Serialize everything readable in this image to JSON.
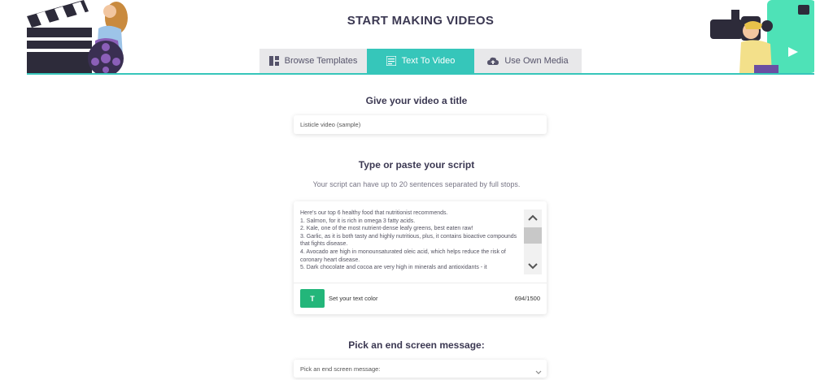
{
  "header": {
    "title": "START MAKING VIDEOS",
    "tabs": [
      {
        "label": "Browse Templates",
        "icon": "grid-icon",
        "active": false
      },
      {
        "label": "Text To Video",
        "icon": "document-icon",
        "active": true
      },
      {
        "label": "Use Own Media",
        "icon": "cloud-upload-icon",
        "active": false
      }
    ]
  },
  "title_section": {
    "heading": "Give your video a title",
    "input_value": "Listicle video (sample)"
  },
  "script_section": {
    "heading": "Type or paste your script",
    "hint": "Your script can have up to 20 sentences separated by full stops.",
    "text": "Here's our top 6 healthy food that nutritionist recommends.\n1. Salmon, for it is rich in omega 3 fatty acids.\n2. Kale, one of the most nutrient-dense leafy greens, best eaten raw!\n3. Garlic, as it is both tasty and highly nutritious, plus, it contains bioactive compounds that fights disease.\n4. Avocado are high in monounsaturated oleic acid, which helps reduce the risk of coronary heart disease.\n5. Dark chocolate and cocoa are very high in minerals and antioxidants - it",
    "text_color_button": "T",
    "text_color_label": "Set your text color",
    "char_count": "694/1500"
  },
  "end_screen_section": {
    "heading": "Pick an end screen message:",
    "select_value": "Pick an end screen message:"
  },
  "colors": {
    "accent": "#36c6ba",
    "text_color_button": "#23b67a",
    "heading": "#3b3852"
  }
}
